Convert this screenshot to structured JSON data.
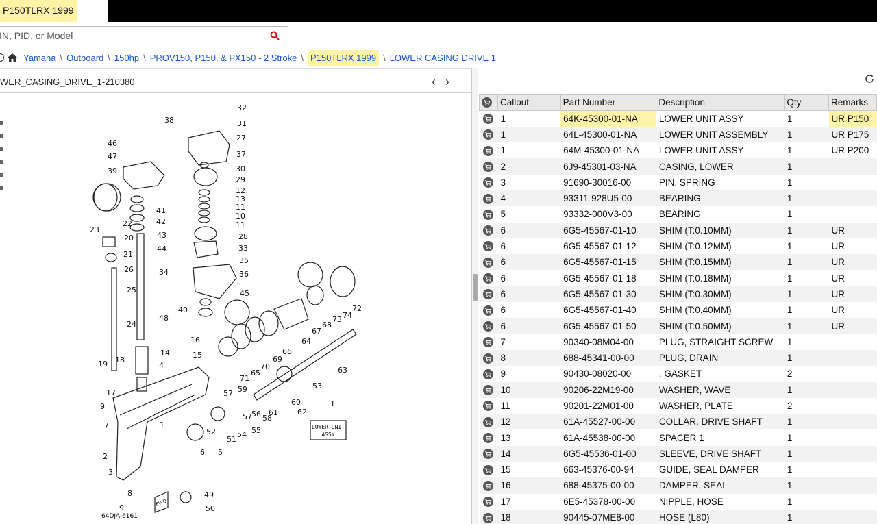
{
  "tab": {
    "title": "P150TLRX 1999"
  },
  "search": {
    "placeholder": "IN, PID, or Model"
  },
  "breadcrumb": {
    "items": [
      "Yamaha",
      "Outboard",
      "150hp",
      "PROV150, P150, & PX150 - 2 Stroke",
      "P150TLRX 1999",
      "LOWER CASING DRIVE 1"
    ]
  },
  "diagram": {
    "title": "WER_CASING_DRIVE_1-210380",
    "code": "64DJA-6161",
    "label_lower_unit": "LOWER UNIT",
    "label_assy": "ASSY",
    "label_fwd": "FWD",
    "callouts": [
      "32",
      "31",
      "27",
      "37",
      "30",
      "29",
      "12",
      "13",
      "11",
      "10",
      "11",
      "28",
      "33",
      "35",
      "36",
      "45",
      "38",
      "46",
      "47",
      "39",
      "41",
      "42",
      "43",
      "44",
      "22",
      "20",
      "21",
      "26",
      "23",
      "25",
      "34",
      "24",
      "48",
      "40",
      "16",
      "14",
      "15",
      "19",
      "18",
      "17",
      "9",
      "7",
      "2",
      "3",
      "8",
      "9",
      "1",
      "4",
      "6",
      "5",
      "52",
      "51",
      "54",
      "57",
      "55",
      "58",
      "57",
      "59",
      "56",
      "61",
      "60",
      "62",
      "53",
      "63",
      "67",
      "68",
      "73",
      "74",
      "72",
      "64",
      "66",
      "69",
      "70",
      "65",
      "71",
      "49",
      "50",
      "1"
    ]
  },
  "table": {
    "headers": [
      "Callout",
      "Part Number",
      "Description",
      "Qty",
      "Remarks"
    ],
    "rows": [
      [
        "1",
        "64K-45300-01-NA",
        "LOWER UNIT ASSY",
        "1",
        "UR P150"
      ],
      [
        "1",
        "64L-45300-01-NA",
        "LOWER UNIT ASSEMBLY",
        "1",
        "UR P175"
      ],
      [
        "1",
        "64M-45300-01-NA",
        "LOWER UNIT ASSY",
        "1",
        "UR P200"
      ],
      [
        "2",
        "6J9-45301-03-NA",
        "CASING, LOWER",
        "1",
        ""
      ],
      [
        "3",
        "91690-30016-00",
        "PIN, SPRING",
        "1",
        ""
      ],
      [
        "4",
        "93311-928U5-00",
        "BEARING",
        "1",
        ""
      ],
      [
        "5",
        "93332-000V3-00",
        "BEARING",
        "1",
        ""
      ],
      [
        "6",
        "6G5-45567-01-10",
        "SHIM (T:0.10MM)",
        "1",
        "UR"
      ],
      [
        "6",
        "6G5-45567-01-12",
        "SHIM (T:0.12MM)",
        "1",
        "UR"
      ],
      [
        "6",
        "6G5-45567-01-15",
        "SHIM (T:0.15MM)",
        "1",
        "UR"
      ],
      [
        "6",
        "6G5-45567-01-18",
        "SHIM (T:0.18MM)",
        "1",
        "UR"
      ],
      [
        "6",
        "6G5-45567-01-30",
        "SHIM (T:0.30MM)",
        "1",
        "UR"
      ],
      [
        "6",
        "6G5-45567-01-40",
        "SHIM (T:0.40MM)",
        "1",
        "UR"
      ],
      [
        "6",
        "6G5-45567-01-50",
        "SHIM (T:0.50MM)",
        "1",
        "UR"
      ],
      [
        "7",
        "90340-08M04-00",
        "PLUG, STRAIGHT SCREW",
        "1",
        ""
      ],
      [
        "8",
        "688-45341-00-00",
        "PLUG, DRAIN",
        "1",
        ""
      ],
      [
        "9",
        "90430-08020-00",
        ". GASKET",
        "2",
        ""
      ],
      [
        "10",
        "90206-22M19-00",
        "WASHER, WAVE",
        "1",
        ""
      ],
      [
        "11",
        "90201-22M01-00",
        "WASHER, PLATE",
        "2",
        ""
      ],
      [
        "12",
        "61A-45527-00-00",
        "COLLAR, DRIVE SHAFT",
        "1",
        ""
      ],
      [
        "13",
        "61A-45538-00-00",
        "SPACER 1",
        "1",
        ""
      ],
      [
        "14",
        "6G5-45536-01-00",
        "SLEEVE, DRIVE SHAFT",
        "1",
        ""
      ],
      [
        "15",
        "663-45376-00-94",
        "GUIDE, SEAL DAMPER",
        "1",
        ""
      ],
      [
        "16",
        "688-45375-00-00",
        "DAMPER, SEAL",
        "1",
        ""
      ],
      [
        "17",
        "6E5-45378-00-00",
        "NIPPLE, HOSE",
        "1",
        ""
      ],
      [
        "18",
        "90445-07ME8-00",
        "HOSE (L80)",
        "1",
        ""
      ]
    ]
  },
  "colors": {
    "highlight": "#fff3a8",
    "link": "#1a58c8",
    "accent_red": "#d01010"
  }
}
